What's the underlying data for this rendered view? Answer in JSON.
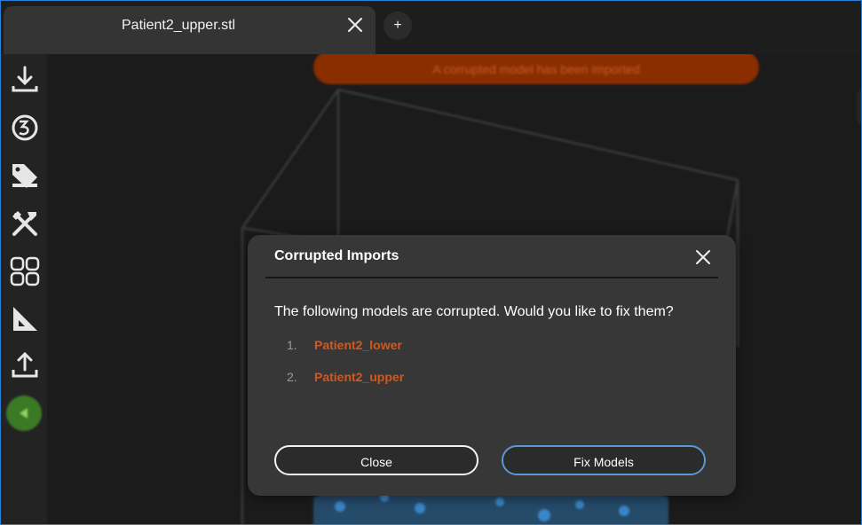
{
  "tabs": [
    {
      "label": "Patient2_upper.stl"
    }
  ],
  "new_tab_label": "+",
  "toolbar": {
    "tools": [
      "download-icon",
      "rotate-3d-icon",
      "tag-icon",
      "tools-icon",
      "grid-icon",
      "measure-icon",
      "upload-icon",
      "back-icon"
    ],
    "accent_green": "#3b7a24"
  },
  "toast": {
    "text": "A corrupted model has been imported",
    "color": "#8a2e00"
  },
  "modal": {
    "title": "Corrupted Imports",
    "message": "The following models are corrupted. Would you like to fix them?",
    "models": [
      {
        "number": "1.",
        "name": "Patient2_lower"
      },
      {
        "number": "2.",
        "name": "Patient2_upper"
      }
    ],
    "close_label": "Close",
    "fix_label": "Fix Models",
    "link_color": "#d7561a",
    "fix_border_color": "#5c97d3"
  }
}
